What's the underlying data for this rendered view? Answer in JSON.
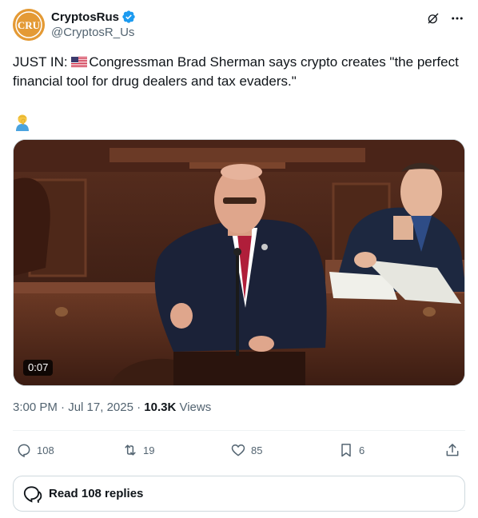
{
  "author": {
    "display_name": "CryptosRus",
    "handle": "@CryptosR_Us",
    "avatar_text": "CRU",
    "verified": true
  },
  "tweet": {
    "lead": "JUST IN: ",
    "flag_icon": "us-flag-icon",
    "text": "Congressman Brad Sherman says crypto creates \"the perfect financial tool for drug dealers and tax evaders.\"",
    "emoji": "person-facepalming-icon"
  },
  "media": {
    "duration": "0:07"
  },
  "meta": {
    "time": "3:00 PM",
    "sep1": " · ",
    "date": "Jul 17, 2025",
    "sep2": " · ",
    "views_count": "10.3K",
    "views_label": " Views"
  },
  "actions": {
    "replies": "108",
    "reposts": "19",
    "likes": "85",
    "bookmarks": "6"
  },
  "read_replies": "Read 108 replies",
  "colors": {
    "accent": "#1d9bf0",
    "text": "#0f1419",
    "secondary": "#536471",
    "border": "#cfd9de"
  }
}
